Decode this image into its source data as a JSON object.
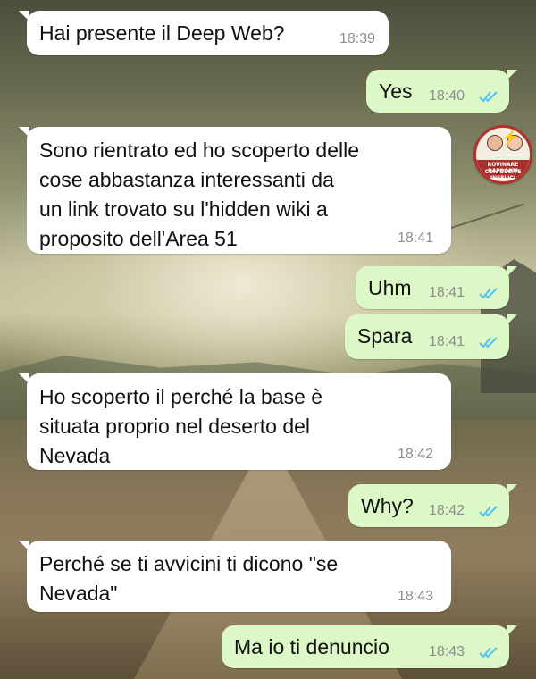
{
  "watermark": {
    "line1": "ROVINARE RAPPORTI",
    "line2": "CON USCITE INFELICI"
  },
  "colors": {
    "incoming_bubble": "#ffffff",
    "outgoing_bubble": "#dcf8c6",
    "read_ticks": "#4fc3f7",
    "timestamp": "#8d8d8d"
  },
  "messages": [
    {
      "direction": "in",
      "text": "Hai presente il Deep Web?",
      "time": "18:39"
    },
    {
      "direction": "out",
      "text": "Yes",
      "time": "18:40",
      "status": "read"
    },
    {
      "direction": "in",
      "text": "Sono rientrato ed ho scoperto delle\ncose abbastanza interessanti da\nun link trovato su l'hidden wiki a\nproposito dell'Area 51",
      "time": "18:41"
    },
    {
      "direction": "out",
      "text": "Uhm",
      "time": "18:41",
      "status": "read"
    },
    {
      "direction": "out",
      "text": "Spara",
      "time": "18:41",
      "status": "read"
    },
    {
      "direction": "in",
      "text": "Ho scoperto il perché la base è\nsituata proprio nel deserto del\nNevada",
      "time": "18:42"
    },
    {
      "direction": "out",
      "text": "Why?",
      "time": "18:42",
      "status": "read"
    },
    {
      "direction": "in",
      "text": "Perché se ti avvicini ti dicono \"se\nNevada\"",
      "time": "18:43"
    },
    {
      "direction": "out",
      "text": "Ma io ti denuncio",
      "time": "18:43",
      "status": "read"
    }
  ]
}
